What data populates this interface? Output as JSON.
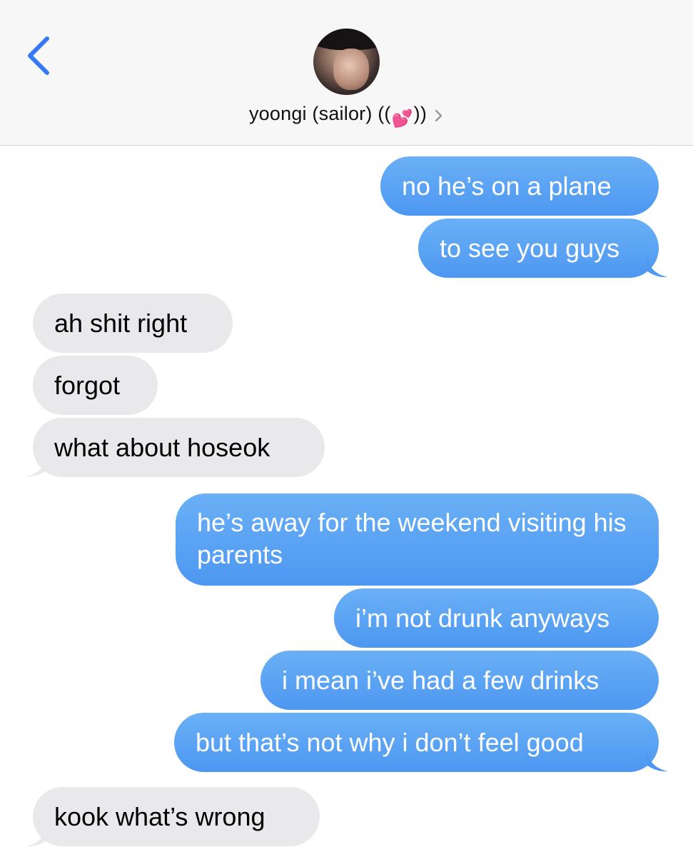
{
  "header": {
    "contact_name_prefix": "yoongi (sailor) ((",
    "contact_emoji": "💕",
    "contact_name_suffix": "))"
  },
  "colors": {
    "sent_top": "#6ab0f6",
    "sent_bottom": "#4d97f1",
    "received": "#e9e9eb",
    "accent": "#3478f6"
  },
  "messages": [
    {
      "from": "me",
      "text": "no he’s on a plane"
    },
    {
      "from": "me",
      "text": "to see you guys"
    },
    {
      "from": "them",
      "text": "ah shit right"
    },
    {
      "from": "them",
      "text": "forgot"
    },
    {
      "from": "them",
      "text": "what about hoseok"
    },
    {
      "from": "me",
      "text": "he’s away for the weekend visiting his parents"
    },
    {
      "from": "me",
      "text": "i’m not drunk anyways"
    },
    {
      "from": "me",
      "text": "i mean i’ve had a few drinks"
    },
    {
      "from": "me",
      "text": "but that’s not why i don’t feel good"
    },
    {
      "from": "them",
      "text": "kook what’s wrong"
    }
  ]
}
